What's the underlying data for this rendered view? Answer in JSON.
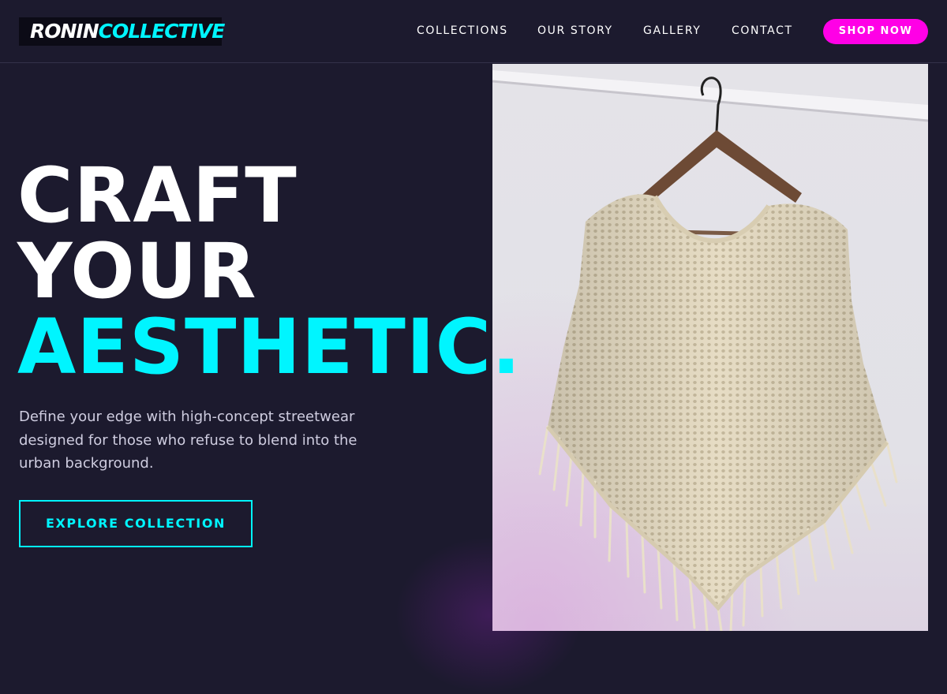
{
  "brand": {
    "part1": "RONIN",
    "part2": "COLLECTIVE"
  },
  "nav": {
    "items": [
      "COLLECTIONS",
      "OUR STORY",
      "GALLERY",
      "CONTACT"
    ],
    "cta": "SHOP NOW"
  },
  "hero": {
    "line1": "CRAFT",
    "line2": "YOUR",
    "line3": "AESTHETIC.",
    "description": "Define your edge with high-concept streetwear designed for those who refuse to blend into the urban background.",
    "button": "EXPLORE COLLECTION",
    "image_subject": "cream crochet fringe poncho on wooden hanger"
  },
  "colors": {
    "background": "#1c1a2e",
    "accent_cyan": "#00f5ff",
    "accent_magenta": "#ff00e6",
    "text": "#ffffff"
  }
}
